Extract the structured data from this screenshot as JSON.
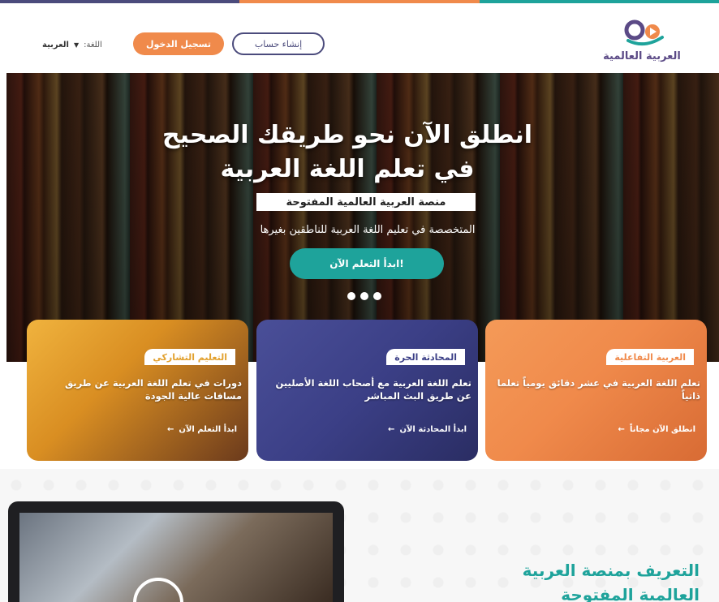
{
  "colors": {
    "accent_orange": "#f08a4b",
    "accent_teal": "#1ea39b",
    "brand_purple": "#4b4b7c",
    "stripe": [
      "#4b4b7c",
      "#f08a4b",
      "#1ea39b"
    ]
  },
  "header": {
    "logo_text": "العربية العالمية",
    "logo_icon": "brand-logo-icon",
    "register_label": "إنشاء حساب",
    "login_label": "تسجيل الدخول",
    "language_label": "اللغة:",
    "language_value": "العربية",
    "language_caret_icon": "caret-down-icon"
  },
  "hero": {
    "title_line1": "انطلق الآن نحو طريقك الصحيح",
    "title_line2": "في تعلم اللغة العربية",
    "badge": "منصة العربية العالمية المفتوحة",
    "subtitle": "المتخصصة في تعليم اللغة العربية  للناطقين بغيرها",
    "cta_label": "ابدأ التعلم الآن!",
    "carousel_dots": 3
  },
  "cards": [
    {
      "label": "العربية التفاعلية",
      "text": "تعلم اللغة العربية في عشر دقائق يومياً تعلما ذاتياً",
      "link": "انطلق الآن مجاناً",
      "link_icon": "arrow-left-icon",
      "color": "#f08a4b"
    },
    {
      "label": "المحادثة الحرة",
      "text": "تعلم اللغة العربية مع أصحاب اللغة الأصليين عن طريق البث المباشر",
      "link": "ابدأ المحادثة الآن",
      "link_icon": "arrow-left-icon",
      "color": "#3b3f86"
    },
    {
      "label": "التعليم التشاركي",
      "text": "دورات في تعلم اللغة العربية عن طريق مسافات عالية الجودة",
      "link": "ابدأ التعلم الآن",
      "link_icon": "arrow-left-icon",
      "color": "#e2a12f"
    }
  ],
  "intro": {
    "title_line1": "التعريف بمنصة العربية",
    "title_line2": "العالمية المفتوحة",
    "play_icon": "play-icon"
  }
}
